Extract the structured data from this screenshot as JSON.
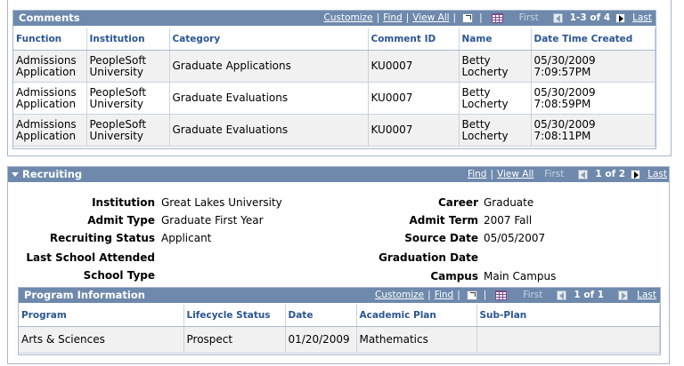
{
  "comments": {
    "title": "Comments",
    "nav": {
      "customize": "Customize",
      "find": "Find",
      "view_all": "View All",
      "first": "First",
      "range": "1-3 of 4",
      "last": "Last"
    },
    "columns": [
      "Function",
      "Institution",
      "Category",
      "Comment ID",
      "Name",
      "Date Time Created"
    ],
    "rows": [
      [
        "Admissions Application",
        "PeopleSoft University",
        "Graduate Applications",
        "KU0007",
        "Betty Locherty",
        "05/30/2009 7:09:57PM"
      ],
      [
        "Admissions Application",
        "PeopleSoft University",
        "Graduate Evaluations",
        "KU0007",
        "Betty Locherty",
        "05/30/2009 7:08:59PM"
      ],
      [
        "Admissions Application",
        "PeopleSoft University",
        "Graduate Evaluations",
        "KU0007",
        "Betty Locherty",
        "05/30/2009 7:08:11PM"
      ]
    ]
  },
  "recruiting": {
    "title": "Recruiting",
    "nav": {
      "find": "Find",
      "view_all": "View All",
      "first": "First",
      "range": "1 of 2",
      "last": "Last"
    },
    "fields": {
      "institution_label": "Institution",
      "institution_value": "Great Lakes University",
      "admit_type_label": "Admit Type",
      "admit_type_value": "Graduate First Year",
      "recruiting_status_label": "Recruiting Status",
      "recruiting_status_value": "Applicant",
      "last_school_label": "Last School Attended",
      "last_school_value": "",
      "school_type_label": "School Type",
      "school_type_value": "",
      "career_label": "Career",
      "career_value": "Graduate",
      "admit_term_label": "Admit Term",
      "admit_term_value": "2007 Fall",
      "source_date_label": "Source Date",
      "source_date_value": "05/05/2007",
      "graduation_date_label": "Graduation Date",
      "graduation_date_value": "",
      "campus_label": "Campus",
      "campus_value": "Main Campus"
    }
  },
  "program": {
    "title": "Program Information",
    "nav": {
      "customize": "Customize",
      "find": "Find",
      "first": "First",
      "range": "1 of 1",
      "last": "Last"
    },
    "columns": [
      "Program",
      "Lifecycle Status",
      "Date",
      "Academic Plan",
      "Sub-Plan"
    ],
    "rows": [
      [
        "Arts & Sciences",
        "Prospect",
        "01/20/2009",
        "Mathematics",
        ""
      ]
    ]
  }
}
